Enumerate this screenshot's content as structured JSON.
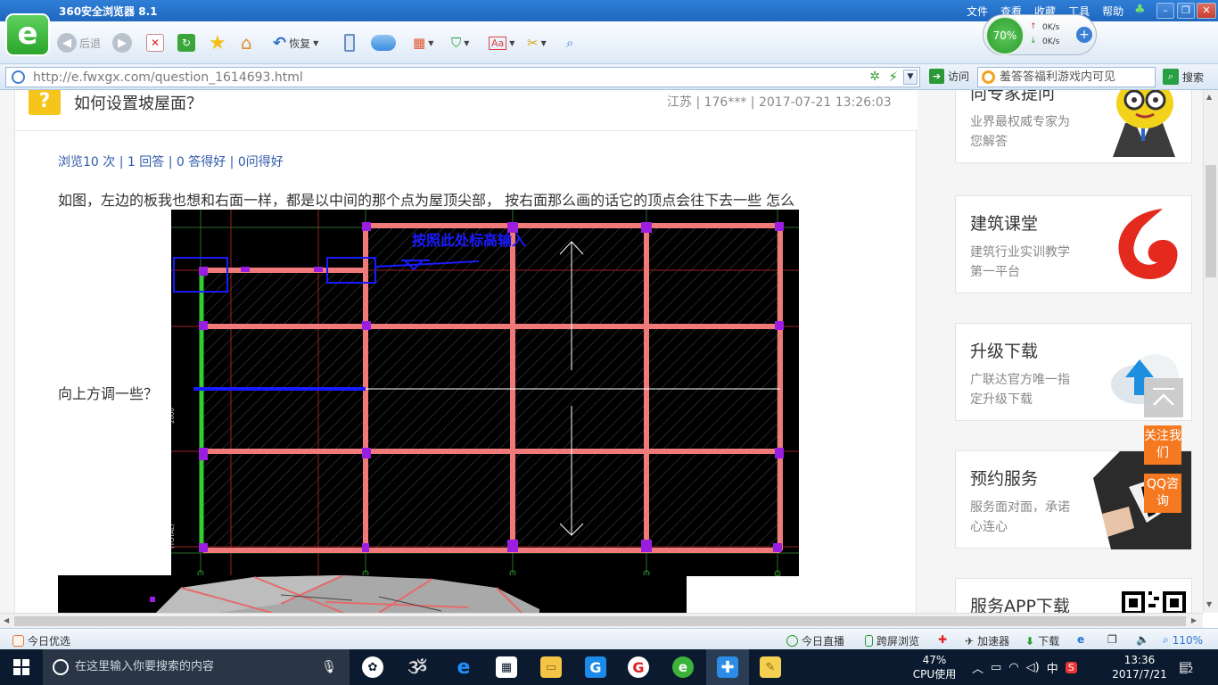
{
  "browser": {
    "title": "360安全浏览器 8.1",
    "menus": [
      "文件",
      "查看",
      "收藏",
      "工具",
      "帮助"
    ],
    "toolbar": {
      "back": "后退",
      "restore": "恢复"
    },
    "speed": {
      "percent": "70%",
      "up": "0K/s",
      "down": "0K/s"
    },
    "address": "http://e.fwxgx.com/question_1614693.html",
    "visit": "访问",
    "search_value": "羞答答福利游戏内可见",
    "search_btn": "搜索"
  },
  "question": {
    "title": "如何设置坡屋面？",
    "meta": "江苏 | 176*** | 2017-07-21 13:26:03",
    "stats": "浏览10 次 | 1 回答 | 0 答得好 | 0问得好",
    "body_line1": "如图，左边的板我也想和右面一样，都是以中间的那个点为屋顶尖部，  按右面那么画的话它的顶点会往下去一些  怎么",
    "body_line2": "向上方调一些？",
    "image_annotation": "按照此处标高输入"
  },
  "sidebar": [
    {
      "title": "向专家提问",
      "desc": "业界最权威专家为您解答",
      "icon": "expert-mascot-icon"
    },
    {
      "title": "建筑课堂",
      "desc": "建筑行业实训教学第一平台",
      "icon": "course-logo-icon"
    },
    {
      "title": "升级下载",
      "desc": "广联达官方唯一指定升级下载",
      "icon": "cloud-upload-icon"
    },
    {
      "title": "预约服务",
      "desc": "服务面对面，承诺心连心",
      "icon": "service-person-icon"
    },
    {
      "title": "服务APP下载",
      "desc": "",
      "icon": "qr-code-icon"
    }
  ],
  "float": {
    "follow": "关注我们",
    "qq": "QQ咨询"
  },
  "statusbar": {
    "today": "今日优选",
    "live": "今日直播",
    "cross": "跨屏浏览",
    "accel": "加速器",
    "download": "下载",
    "zoom": "110%"
  },
  "taskbar": {
    "search_placeholder": "在这里输入你要搜索的内容",
    "cpu_percent": "47%",
    "cpu_label": "CPU使用",
    "ime": "中",
    "time": "13:36",
    "date": "2017/7/21",
    "notifications": "2"
  },
  "colors": {
    "chrome_blue": "#2a74cf",
    "beam_pink": "#f07a7a",
    "column_purple": "#9a1ee0",
    "annotation_blue": "#1a1aff",
    "wall_green": "#33cc33",
    "float_orange": "#f47920"
  }
}
